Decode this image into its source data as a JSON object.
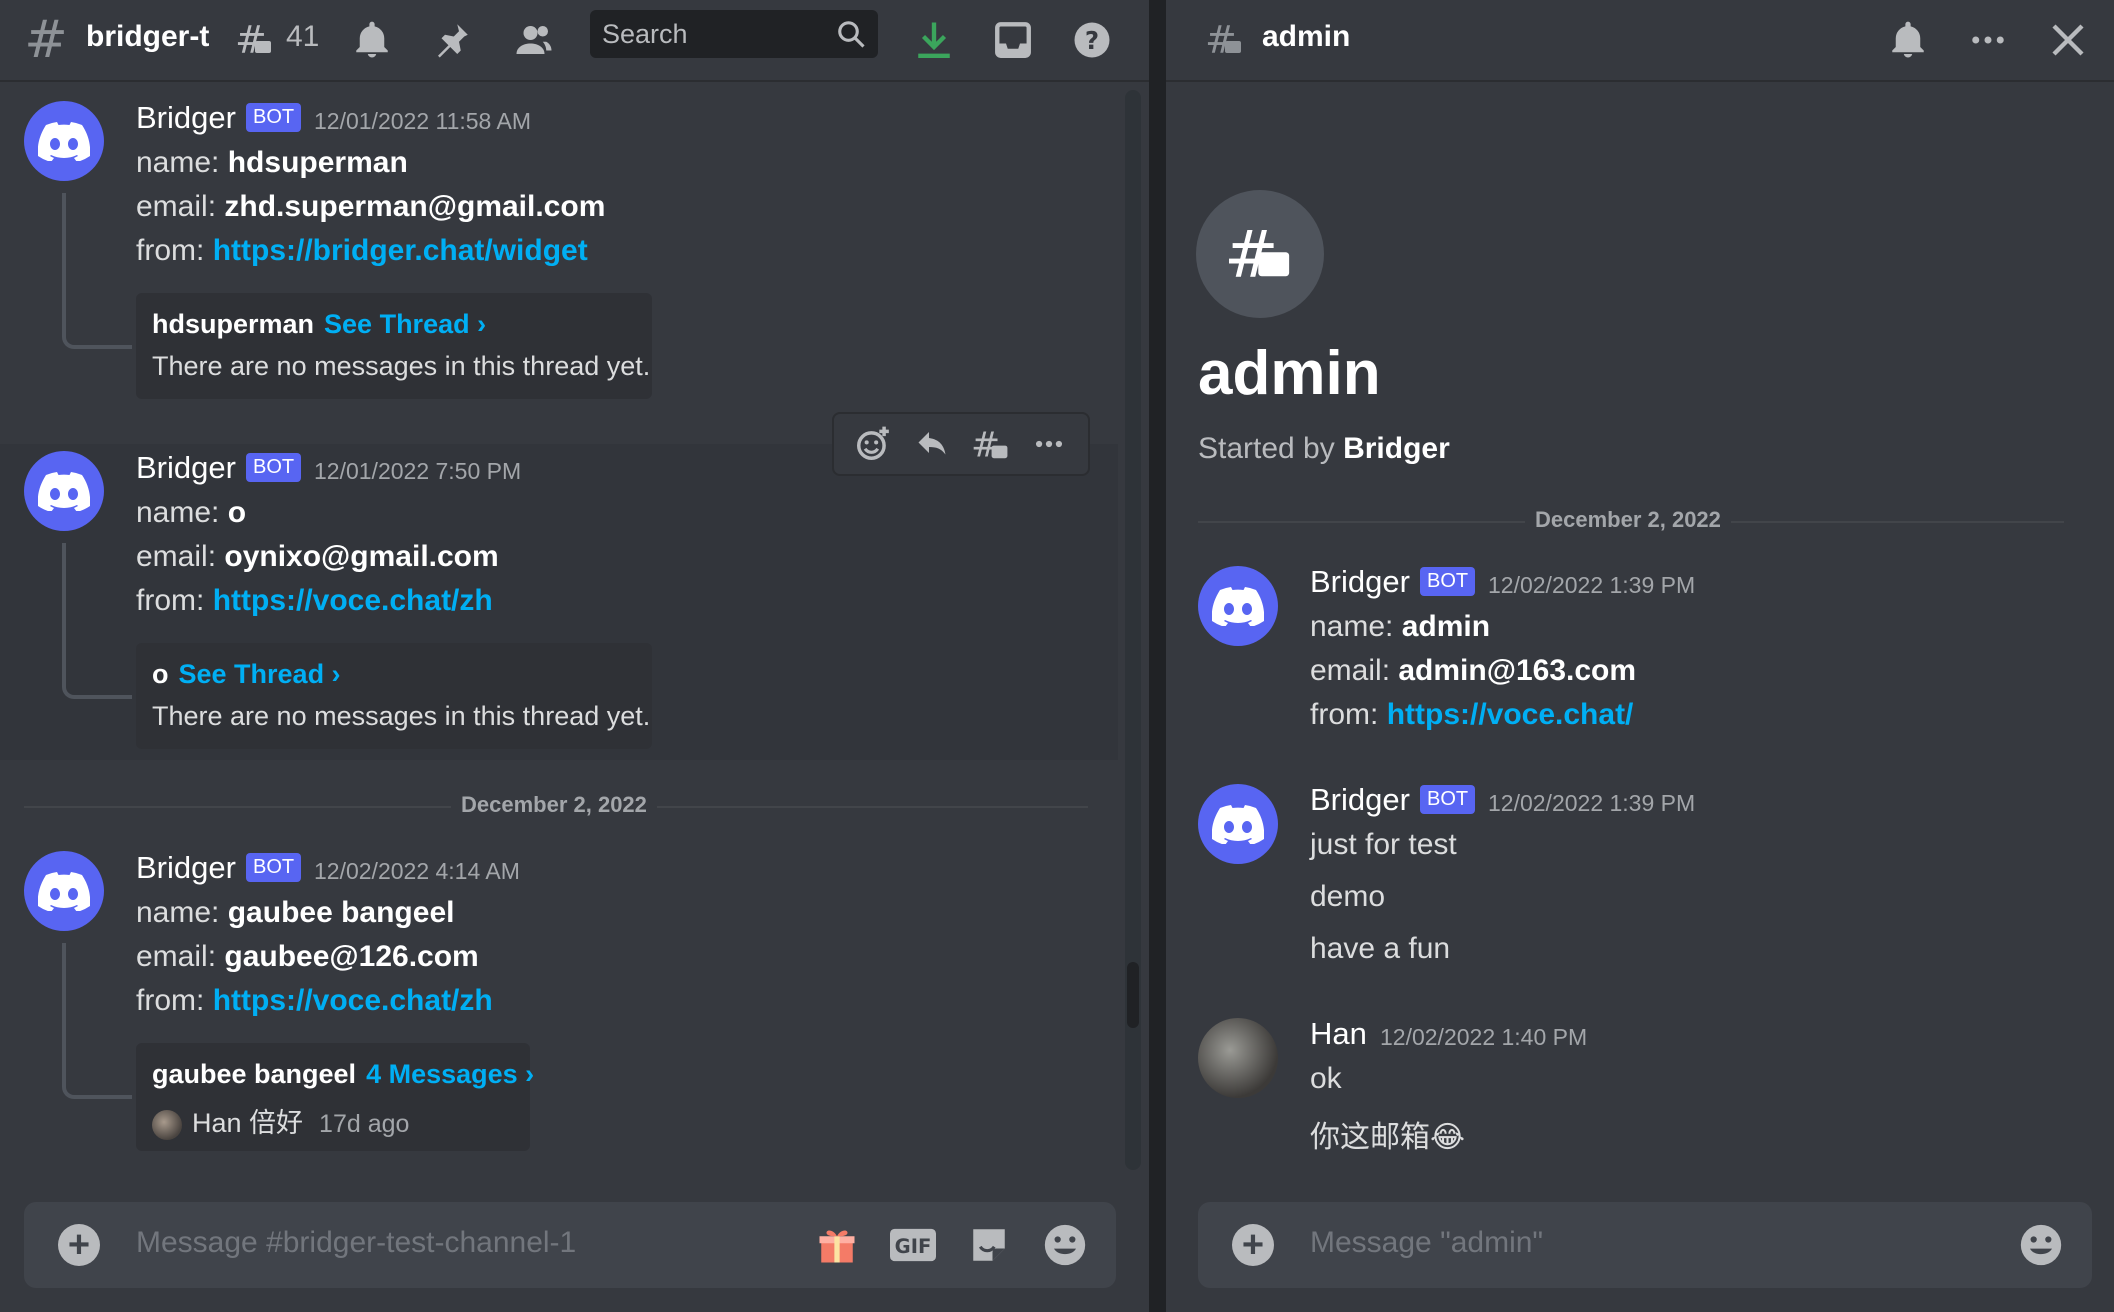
{
  "left": {
    "header": {
      "channel": "bridger-t",
      "threads_count": "41",
      "search_placeholder": "Search"
    },
    "messages": [
      {
        "user": "Bridger",
        "badge": "BOT",
        "time": "12/01/2022 11:58 AM",
        "name_label": "name:",
        "name": "hdsuperman",
        "email_label": "email:",
        "email": "zhd.superman@gmail.com",
        "from_label": "from:",
        "from": "https://bridger.chat/widget",
        "thread": {
          "title": "hdsuperman",
          "link": "See Thread ›",
          "body": "There are no messages in this thread yet."
        }
      },
      {
        "user": "Bridger",
        "badge": "BOT",
        "time": "12/01/2022 7:50 PM",
        "name_label": "name:",
        "name": "o",
        "email_label": "email:",
        "email": "oynixo@gmail.com",
        "from_label": "from:",
        "from": "https://voce.chat/zh",
        "thread": {
          "title": "o",
          "link": "See Thread ›",
          "body": "There are no messages in this thread yet."
        }
      },
      {
        "user": "Bridger",
        "badge": "BOT",
        "time": "12/02/2022 4:14 AM",
        "name_label": "name:",
        "name": "gaubee bangeel",
        "email_label": "email:",
        "email": "gaubee@126.com",
        "from_label": "from:",
        "from": "https://voce.chat/zh",
        "thread": {
          "title": "gaubee bangeel",
          "link": "4 Messages ›",
          "last_user": "Han 倍好",
          "last_time": "17d ago"
        }
      }
    ],
    "date_divider": "December 2, 2022",
    "composer_placeholder": "Message #bridger-test-channel-1"
  },
  "right": {
    "header": {
      "title": "admin"
    },
    "thread_title": "admin",
    "started_by_label": "Started by",
    "started_by": "Bridger",
    "date_divider": "December 2, 2022",
    "messages": [
      {
        "user": "Bridger",
        "badge": "BOT",
        "time": "12/02/2022 1:39 PM",
        "name_label": "name:",
        "name": "admin",
        "email_label": "email:",
        "email": "admin@163.com",
        "from_label": "from:",
        "from": "https://voce.chat/"
      },
      {
        "user": "Bridger",
        "badge": "BOT",
        "time": "12/02/2022 1:39 PM",
        "lines": [
          "just for test",
          "demo",
          "have a fun"
        ]
      },
      {
        "user": "Han",
        "time": "12/02/2022 1:40 PM",
        "lines": [
          "ok",
          "你这邮箱😂"
        ]
      }
    ],
    "composer_placeholder": "Message \"admin\""
  },
  "colors": {
    "blurple": "#5865f2",
    "link": "#00aff4",
    "download": "#3ba55c",
    "background": "#36393f"
  }
}
